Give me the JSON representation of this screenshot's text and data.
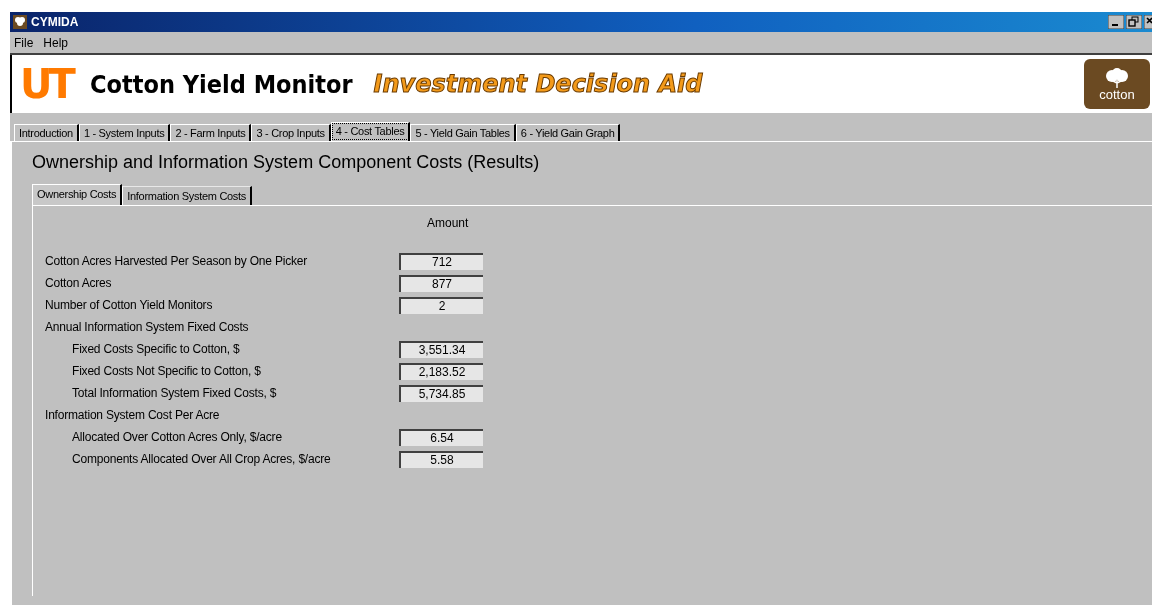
{
  "window": {
    "title": "CYMIDA"
  },
  "menu": [
    "File",
    "Help"
  ],
  "banner": {
    "logo_text": "UT",
    "title": "Cotton Yield Monitor",
    "subtitle": "Investment Decision Aid",
    "badge_text": "cotton"
  },
  "tabs": [
    {
      "label": "Introduction",
      "selected": false
    },
    {
      "label": "1 - System Inputs",
      "selected": false
    },
    {
      "label": "2 - Farm Inputs",
      "selected": false
    },
    {
      "label": "3 - Crop Inputs",
      "selected": false
    },
    {
      "label": "4 - Cost Tables",
      "selected": true
    },
    {
      "label": "5 - Yield Gain Tables",
      "selected": false
    },
    {
      "label": "6 - Yield Gain Graph",
      "selected": false
    }
  ],
  "heading": "Ownership and Information System Component Costs (Results)",
  "subtabs": [
    {
      "label": "Ownership Costs",
      "selected": true
    },
    {
      "label": "Information System Costs",
      "selected": false
    }
  ],
  "column_header": "Amount",
  "rows": [
    {
      "label": "Cotton Acres Harvested Per Season by One Picker",
      "value": "712"
    },
    {
      "label": "Cotton Acres",
      "value": "877"
    },
    {
      "label": "Number of Cotton Yield Monitors",
      "value": "2"
    },
    {
      "label": "Annual Information System Fixed Costs",
      "children": [
        {
          "label": "Fixed Costs Specific to Cotton, $",
          "value": "3,551.34"
        },
        {
          "label": "Fixed Costs Not Specific to Cotton, $",
          "value": "2,183.52"
        },
        {
          "label": "Total Information System Fixed Costs, $",
          "value": "5,734.85"
        }
      ]
    },
    {
      "label": "Information System Cost Per Acre",
      "children": [
        {
          "label": "Allocated Over Cotton Acres Only, $/acre",
          "value": "6.54"
        },
        {
          "label": "Components Allocated Over All Crop Acres, $/acre",
          "value": "5.58"
        }
      ]
    }
  ]
}
